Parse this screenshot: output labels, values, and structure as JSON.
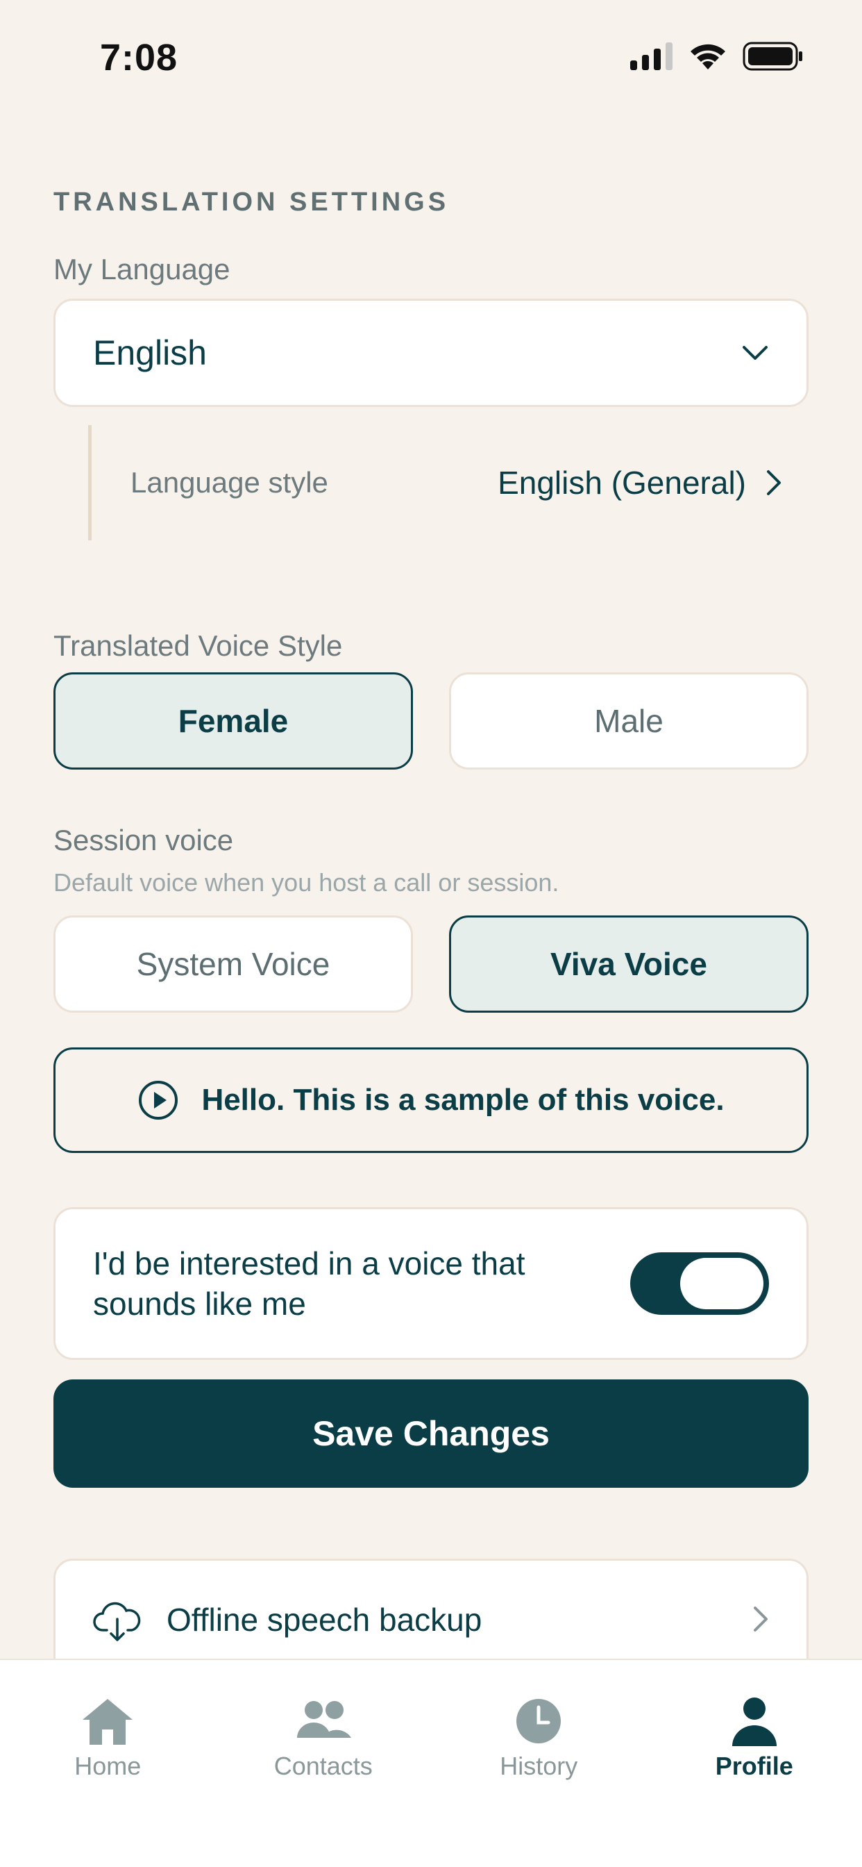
{
  "status_bar": {
    "time": "7:08"
  },
  "translation_settings": {
    "section_title": "TRANSLATION SETTINGS",
    "my_language_label": "My Language",
    "my_language_value": "English",
    "language_style_label": "Language style",
    "language_style_value": "English (General)"
  },
  "voice_style": {
    "label": "Translated Voice Style",
    "options": [
      "Female",
      "Male"
    ],
    "selected": "Female"
  },
  "session_voice": {
    "label": "Session voice",
    "description": "Default voice when you host a call or session.",
    "options": [
      "System Voice",
      "Viva Voice"
    ],
    "selected": "Viva Voice"
  },
  "sample": {
    "text": "Hello. This is a sample of this voice."
  },
  "voice_like_me": {
    "text": "I'd be interested in a voice that sounds like me",
    "enabled": true
  },
  "save_button": {
    "label": "Save Changes"
  },
  "offline_backup": {
    "label": "Offline speech backup"
  },
  "tabbar": {
    "items": [
      {
        "label": "Home",
        "icon": "home-icon"
      },
      {
        "label": "Contacts",
        "icon": "contacts-icon"
      },
      {
        "label": "History",
        "icon": "clock-icon"
      },
      {
        "label": "Profile",
        "icon": "person-icon"
      }
    ],
    "active": "Profile"
  },
  "colors": {
    "accent": "#0a3d45",
    "background": "#f7f2ec",
    "selected_fill": "#e6eeeb"
  }
}
